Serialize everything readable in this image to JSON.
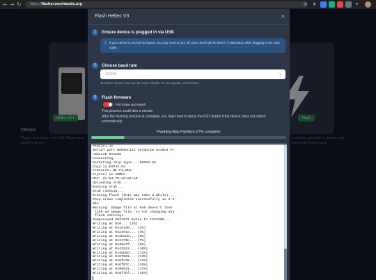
{
  "browser": {
    "url_proto": "https://",
    "url_host": "flasher.meshtastic.org",
    "nav_icons": [
      "back-icon",
      "forward-icon",
      "reload-icon"
    ],
    "toolbar_icons": [
      "install-icon",
      "star-icon",
      "extension-icon",
      "extension-icon",
      "extension-icon",
      "extension-icon",
      "puzzle-icon",
      "menu-icon"
    ]
  },
  "background": {
    "device_button_label": "Heltec V3 ▾",
    "flash_button_label": "Flash",
    "device_heading": "Device",
    "device_text_line1": "Plug in your device via USB. Please ensu",
    "device_text_line2": "power only one.",
    "right_text_line1": "e whether you wish to update your",
    "right_text_line2": "and install from scratch."
  },
  "modal": {
    "title": "Flash Heltec V3",
    "close_glyph": "×",
    "steps": [
      {
        "num": "1",
        "title": "Ensure device is plugged in via USB"
      },
      {
        "num": "2",
        "title": "Choose baud rate"
      },
      {
        "num": "3",
        "title": "Flash firmware"
      }
    ],
    "alert_icon": "ⓘ",
    "alert_text": "If your device is ESP32-S3 based, you may need to turn off, press and hold the BOOT / USB button while plugging in the USB cable.",
    "baud": {
      "value": "115200",
      "help": "115200 is slower, but can be more reliable for low-quality connections."
    },
    "toggle_label": "Full Erase and Install",
    "toggle_on": true,
    "flash_line1": "This process could take a minute.",
    "flash_line2": "After the flashing process is complete, you may need to press the RST button if the device does not reboot automatically.",
    "progress": {
      "label": "Flashing App Partition 17% complete",
      "percent": 17
    },
    "console_lines": [
      "esptool.js",
      "Serial port WebSerial VendorID 0x10c4 Pr",
      "oductID 0xea60",
      "Connecting....",
      "Detecting chip type... ESP32-S3",
      "Chip is ESP32-S3",
      "Features: Wi-Fi,BLE",
      "Crystal is 40MHz",
      "MAC: dc:54:75:e9:86:a0",
      "Uploading stub...",
      "Running stub...",
      "Stub running...",
      "Erasing flash (this may take a while)...",
      "Chip erase completed successfully in 2.1",
      "94s",
      "Warning: Image file at 0x0 doesn't look",
      " like an image file, so not changing any",
      " flash settings.",
      "Compressed 2037872 bytes to 1224396...",
      "Writing at 0x0... (1%)",
      "Writing at 0x1e336... (2%)",
      "Writing at 0x24e1d... (4%)",
      "Writing at 0x2b2dd... (5%)",
      "Writing at 0x3175b... (7%)",
      "Writing at 0x35e7f... (9%)",
      "Writing at 0x42513... (10%)",
      "Writing at 0x4dd5d... (12%)",
      "Writing at 0x57681... (13%)",
      "Writing at 0x5fc39... (14%)",
      "Writing at 0x6f87c... (16%)",
      "Writing at 0x86931... (17%)",
      "Writing at 0x8f7bf... (18%)"
    ]
  }
}
